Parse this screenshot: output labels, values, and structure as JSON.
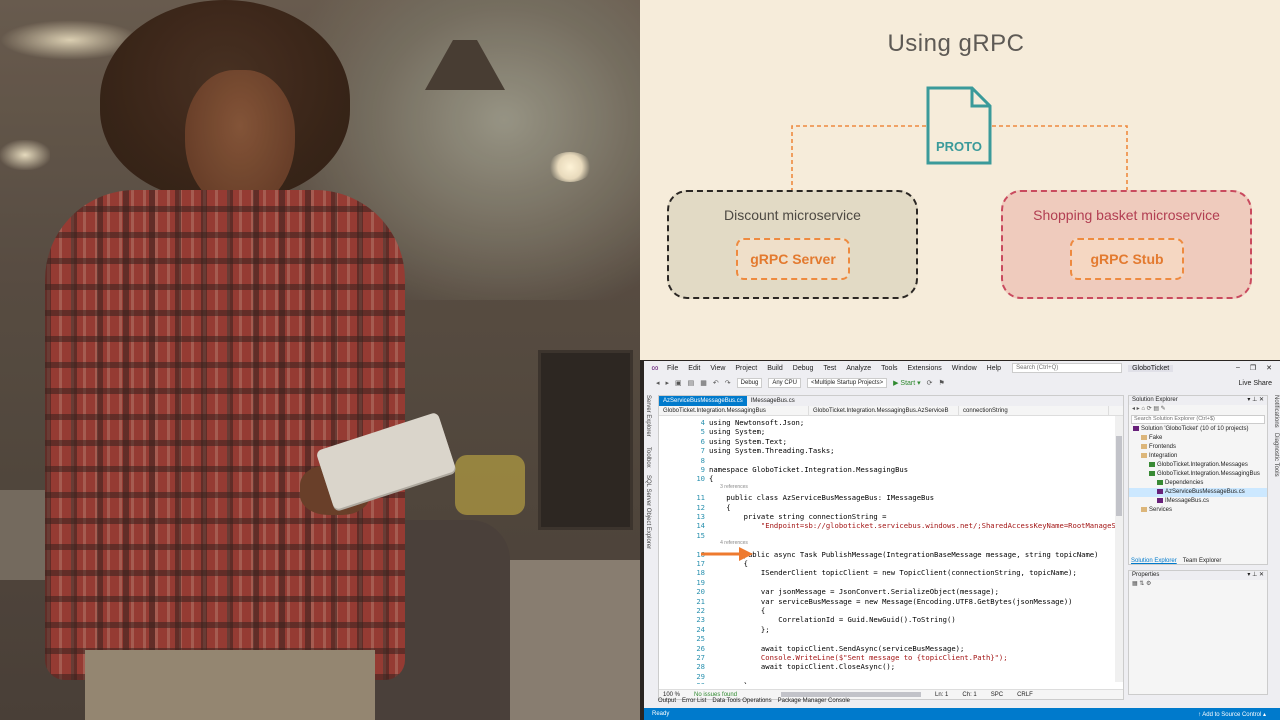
{
  "slide": {
    "title": "Using gRPC",
    "proto_label": "PROTO",
    "discount": {
      "title": "Discount microservice",
      "inner": "gRPC Server"
    },
    "shopping": {
      "title": "Shopping basket microservice",
      "inner": "gRPC Stub"
    },
    "colors": {
      "background": "#f6ecda",
      "teal": "#3a9a9a",
      "orange": "#ee8a3f",
      "rose": "#c94a5e"
    }
  },
  "vs": {
    "menu": [
      "File",
      "Edit",
      "View",
      "Project",
      "Build",
      "Debug",
      "Test",
      "Analyze",
      "Tools",
      "Extensions",
      "Window",
      "Help"
    ],
    "search_placeholder": "Search (Ctrl+Q)",
    "solution_name": "GloboTicket",
    "toolbar": {
      "config": "Debug",
      "platform": "Any CPU",
      "startup": "<Multiple Startup Projects>",
      "start": "▶ Start ▾",
      "live_share": "Live Share"
    },
    "left_tabs": [
      "Server Explorer",
      "Toolbox",
      "SQL Server Object Explorer"
    ],
    "right_tabs": [
      "Notifications",
      "Diagnostic Tools"
    ],
    "tabs": [
      "AzServiceBusMessageBus.cs",
      "IMessageBus.cs"
    ],
    "nav": [
      "GloboTicket.Integration.MessagingBus",
      "GloboTicket.Integration.MessagingBus.AzServiceB",
      "connectionString"
    ],
    "code_lines": [
      {
        "n": "4",
        "t": "using Newtonsoft.Json;"
      },
      {
        "n": "5",
        "t": "using System;"
      },
      {
        "n": "6",
        "t": "using System.Text;"
      },
      {
        "n": "7",
        "t": "using System.Threading.Tasks;"
      },
      {
        "n": "8",
        "t": ""
      },
      {
        "n": "9",
        "t": "namespace GloboTicket.Integration.MessagingBus"
      },
      {
        "n": "10",
        "t": "{"
      },
      {
        "n": "",
        "t": "        3 references",
        "ref": true
      },
      {
        "n": "11",
        "t": "    public class AzServiceBusMessageBus: IMessageBus"
      },
      {
        "n": "12",
        "t": "    {"
      },
      {
        "n": "13",
        "t": "        private string connectionString ="
      },
      {
        "n": "14",
        "t": "            \"Endpoint=sb://globoticket.servicebus.windows.net/;SharedAccessKeyName=RootManageSharedAc"
      },
      {
        "n": "15",
        "t": ""
      },
      {
        "n": "",
        "t": "        4 references",
        "ref": true
      },
      {
        "n": "16",
        "t": "        public async Task PublishMessage(IntegrationBaseMessage message, string topicName)"
      },
      {
        "n": "17",
        "t": "        {"
      },
      {
        "n": "18",
        "t": "            ISenderClient topicClient = new TopicClient(connectionString, topicName);"
      },
      {
        "n": "19",
        "t": ""
      },
      {
        "n": "20",
        "t": "            var jsonMessage = JsonConvert.SerializeObject(message);"
      },
      {
        "n": "21",
        "t": "            var serviceBusMessage = new Message(Encoding.UTF8.GetBytes(jsonMessage))"
      },
      {
        "n": "22",
        "t": "            {"
      },
      {
        "n": "23",
        "t": "                CorrelationId = Guid.NewGuid().ToString()"
      },
      {
        "n": "24",
        "t": "            };"
      },
      {
        "n": "25",
        "t": ""
      },
      {
        "n": "26",
        "t": "            await topicClient.SendAsync(serviceBusMessage);"
      },
      {
        "n": "27",
        "t": "            Console.WriteLine($\"Sent message to {topicClient.Path}\");"
      },
      {
        "n": "28",
        "t": "            await topicClient.CloseAsync();"
      },
      {
        "n": "29",
        "t": ""
      },
      {
        "n": "30",
        "t": "        }"
      }
    ],
    "editor_status": {
      "zoom": "100 %",
      "issues": "No issues found",
      "ln": "Ln: 1",
      "ch": "Ch: 1",
      "spc": "SPC",
      "crlf": "CRLF"
    },
    "bottom_tabs": [
      "Output",
      "Error List",
      "Data Tools Operations",
      "Package Manager Console"
    ],
    "solution_explorer": {
      "title": "Solution Explorer",
      "search": "Search Solution Explorer (Ctrl+$)",
      "items": [
        {
          "label": "Solution 'GloboTicket' (10 of 10 projects)",
          "indent": 0,
          "icon": "solution"
        },
        {
          "label": "Fake",
          "indent": 1,
          "icon": "folder"
        },
        {
          "label": "Frontends",
          "indent": 1,
          "icon": "folder"
        },
        {
          "label": "Integration",
          "indent": 1,
          "icon": "folder"
        },
        {
          "label": "GloboTicket.Integration.Messages",
          "indent": 2,
          "icon": "proj"
        },
        {
          "label": "GloboTicket.Integration.MessagingBus",
          "indent": 2,
          "icon": "proj"
        },
        {
          "label": "Dependencies",
          "indent": 3,
          "icon": "deps"
        },
        {
          "label": "AzServiceBusMessageBus.cs",
          "indent": 3,
          "icon": "cs",
          "selected": true
        },
        {
          "label": "IMessageBus.cs",
          "indent": 3,
          "icon": "cs"
        },
        {
          "label": "Services",
          "indent": 1,
          "icon": "folder"
        }
      ],
      "tabs": [
        "Solution Explorer",
        "Team Explorer"
      ]
    },
    "properties_title": "Properties",
    "status": {
      "ready": "Ready",
      "source_control": "↑ Add to Source Control ▴"
    }
  }
}
